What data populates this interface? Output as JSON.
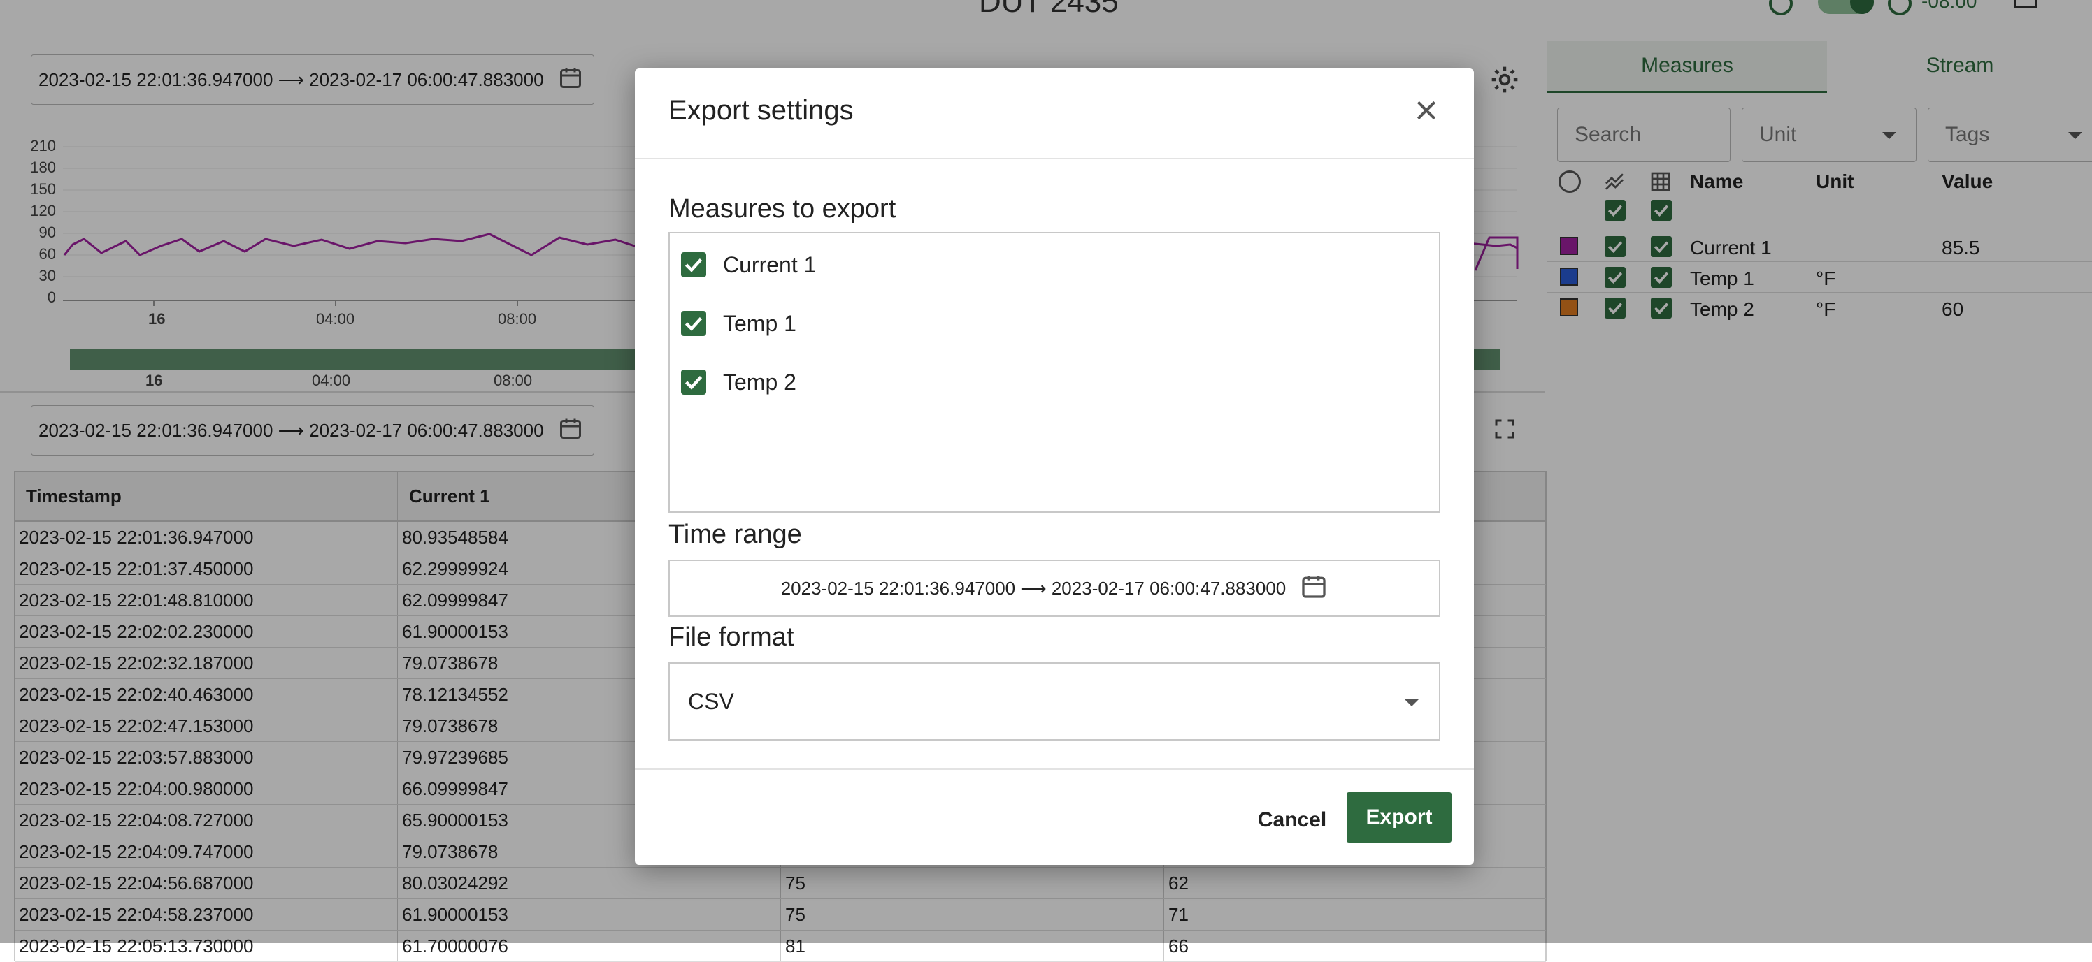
{
  "header": {
    "title": "DUT 2435",
    "time_offset": "-08:00"
  },
  "chart_panel": {
    "range": "2023-02-15 22:01:36.947000 ⟶ 2023-02-17 06:00:47.883000",
    "y_ticks": [
      "210",
      "180",
      "150",
      "120",
      "90",
      "60",
      "30",
      "0"
    ],
    "x_ticks": [
      "16",
      "04:00",
      "08:00"
    ],
    "nav_ticks": [
      "16",
      "04:00",
      "08:00"
    ]
  },
  "table_panel": {
    "range": "2023-02-15 22:01:36.947000 ⟶ 2023-02-17 06:00:47.883000",
    "columns": [
      "Timestamp",
      "Current 1",
      "",
      ""
    ],
    "rows": [
      [
        "2023-02-15 22:01:36.947000",
        "80.93548584",
        "",
        ""
      ],
      [
        "2023-02-15 22:01:37.450000",
        "62.29999924",
        "",
        ""
      ],
      [
        "2023-02-15 22:01:48.810000",
        "62.09999847",
        "",
        ""
      ],
      [
        "2023-02-15 22:02:02.230000",
        "61.90000153",
        "",
        ""
      ],
      [
        "2023-02-15 22:02:32.187000",
        "79.0738678",
        "",
        ""
      ],
      [
        "2023-02-15 22:02:40.463000",
        "78.12134552",
        "",
        ""
      ],
      [
        "2023-02-15 22:02:47.153000",
        "79.0738678",
        "",
        ""
      ],
      [
        "2023-02-15 22:03:57.883000",
        "79.97239685",
        "",
        ""
      ],
      [
        "2023-02-15 22:04:00.980000",
        "66.09999847",
        "",
        ""
      ],
      [
        "2023-02-15 22:04:08.727000",
        "65.90000153",
        "",
        ""
      ],
      [
        "2023-02-15 22:04:09.747000",
        "79.0738678",
        "",
        ""
      ],
      [
        "2023-02-15 22:04:56.687000",
        "80.03024292",
        "75",
        "62"
      ],
      [
        "2023-02-15 22:04:58.237000",
        "61.90000153",
        "75",
        "71"
      ],
      [
        "2023-02-15 22:05:13.730000",
        "61.70000076",
        "81",
        "66"
      ]
    ]
  },
  "right_panel": {
    "tabs": [
      "Measures",
      "Stream"
    ],
    "search_placeholder": "Search",
    "unit_select": "Unit",
    "tags_select": "Tags",
    "columns": {
      "name": "Name",
      "unit": "Unit",
      "value": "Value"
    },
    "measures": [
      {
        "name": "Current 1",
        "unit": "",
        "value": "85.5",
        "color": "#a020a0"
      },
      {
        "name": "Temp 1",
        "unit": "°F",
        "value": "",
        "color": "#2a5bd7"
      },
      {
        "name": "Temp 2",
        "unit": "°F",
        "value": "60",
        "color": "#e07b20"
      }
    ]
  },
  "dialog": {
    "title": "Export settings",
    "measures_heading": "Measures to export",
    "measures": [
      "Current 1",
      "Temp 1",
      "Temp 2"
    ],
    "time_range_heading": "Time range",
    "time_range": "2023-02-15 22:01:36.947000 ⟶ 2023-02-17 06:00:47.883000",
    "file_format_heading": "File format",
    "file_format": "CSV",
    "cancel": "Cancel",
    "export": "Export"
  },
  "colors": {
    "accent": "#2e6b3f",
    "series": "#a020a0"
  }
}
